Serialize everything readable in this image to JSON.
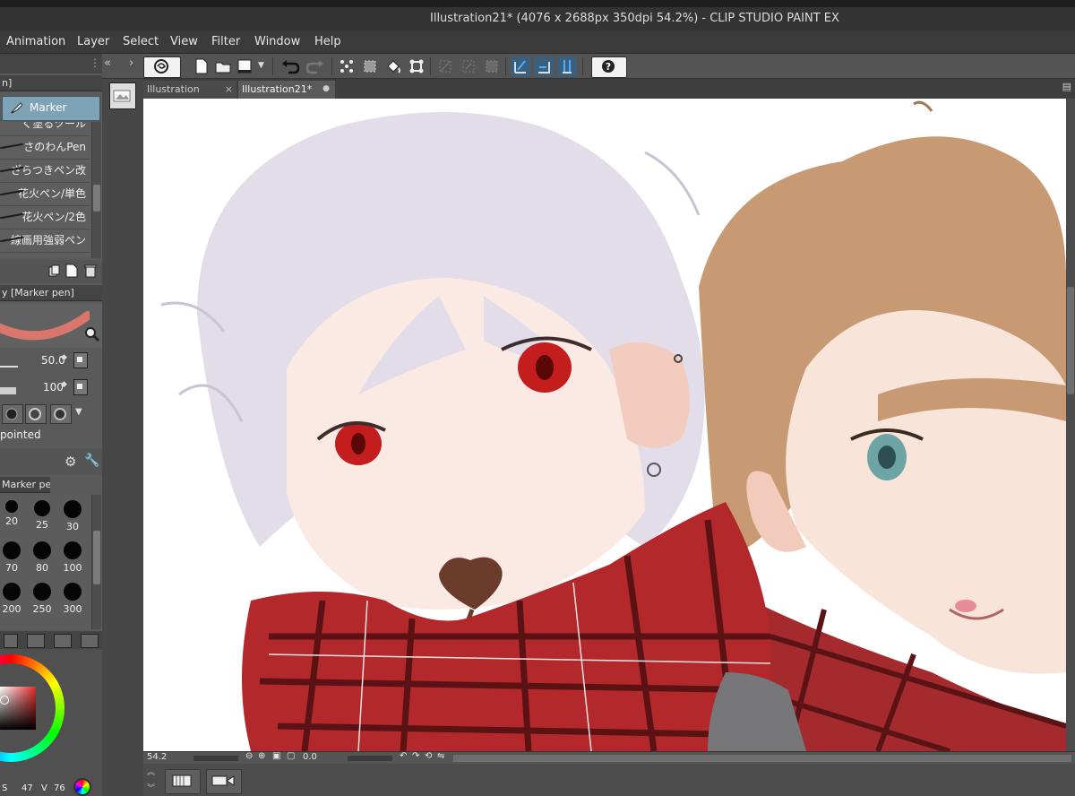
{
  "window": {
    "title": "Illustration21* (4076 x 2688px 350dpi 54.2%)  - CLIP STUDIO PAINT EX"
  },
  "menu": {
    "items": [
      "Animation",
      "Layer",
      "Select",
      "View",
      "Filter",
      "Window",
      "Help"
    ]
  },
  "tabs": [
    {
      "label": "Illustration",
      "close": "×"
    },
    {
      "label": "Illustration21*",
      "close": "●"
    }
  ],
  "left_panel": {
    "subtool_header": "n]",
    "active_subtool": "Marker",
    "brushes": [
      "く塗るツール",
      "さのわんPen",
      "ざらつきペン改",
      "花火ペン/単色",
      "花火ペン/2色",
      "線画用強弱ペン"
    ],
    "tool_property_header": "y [Marker pen]",
    "brush_size_value": "50.0",
    "opacity_value": "100",
    "tip_shape_label": "pointed",
    "brush_size_header": "Marker pen]",
    "brush_sizes": [
      "20",
      "25",
      "30",
      "70",
      "80",
      "100",
      "200",
      "250",
      "300"
    ],
    "color_values": {
      "s": "S",
      "s_value": "47",
      "v": "V",
      "v_value": "76"
    }
  },
  "status": {
    "zoom": "54.2",
    "rotation": "0.0"
  },
  "colors": {
    "accent_blue": "#4a90c8",
    "marker_tab": "#7fa3b6",
    "brush_preview": "#d9776d"
  }
}
